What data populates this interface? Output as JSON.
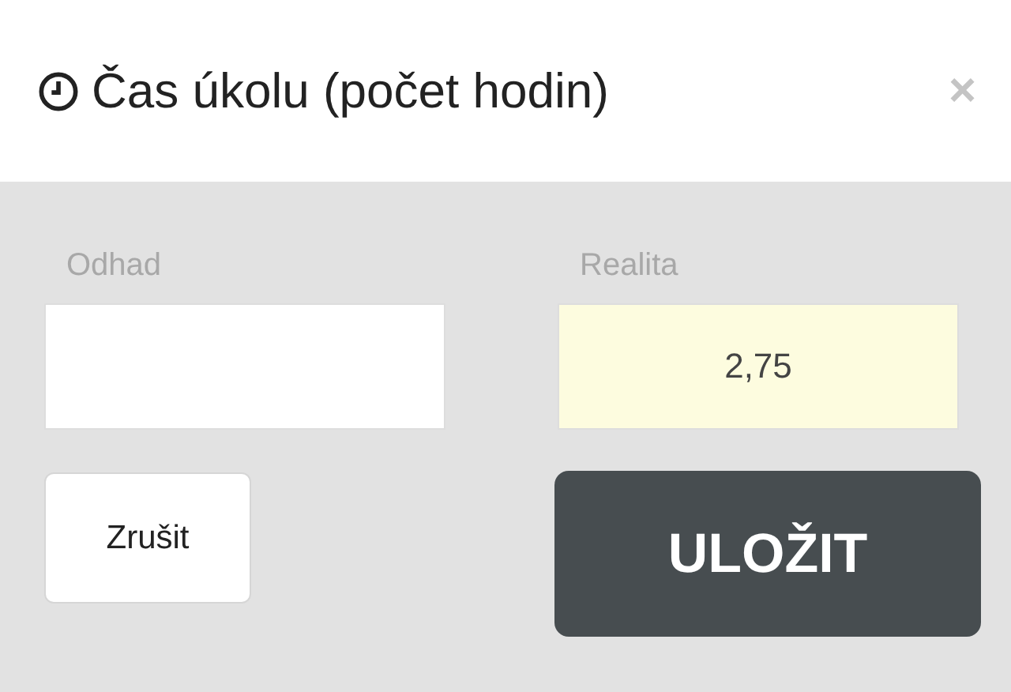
{
  "dialog": {
    "title": "Čas úkolu (počet hodin)",
    "close": "×"
  },
  "fields": [
    {
      "label": "Odhad",
      "kind": "editable"
    },
    {
      "label": "Realita",
      "value": "2,75",
      "kind": "readonly"
    }
  ],
  "buttons": [
    {
      "label": "Zrušit",
      "kind": "secondary"
    },
    {
      "label": "ULOŽIT",
      "kind": "primary"
    }
  ]
}
